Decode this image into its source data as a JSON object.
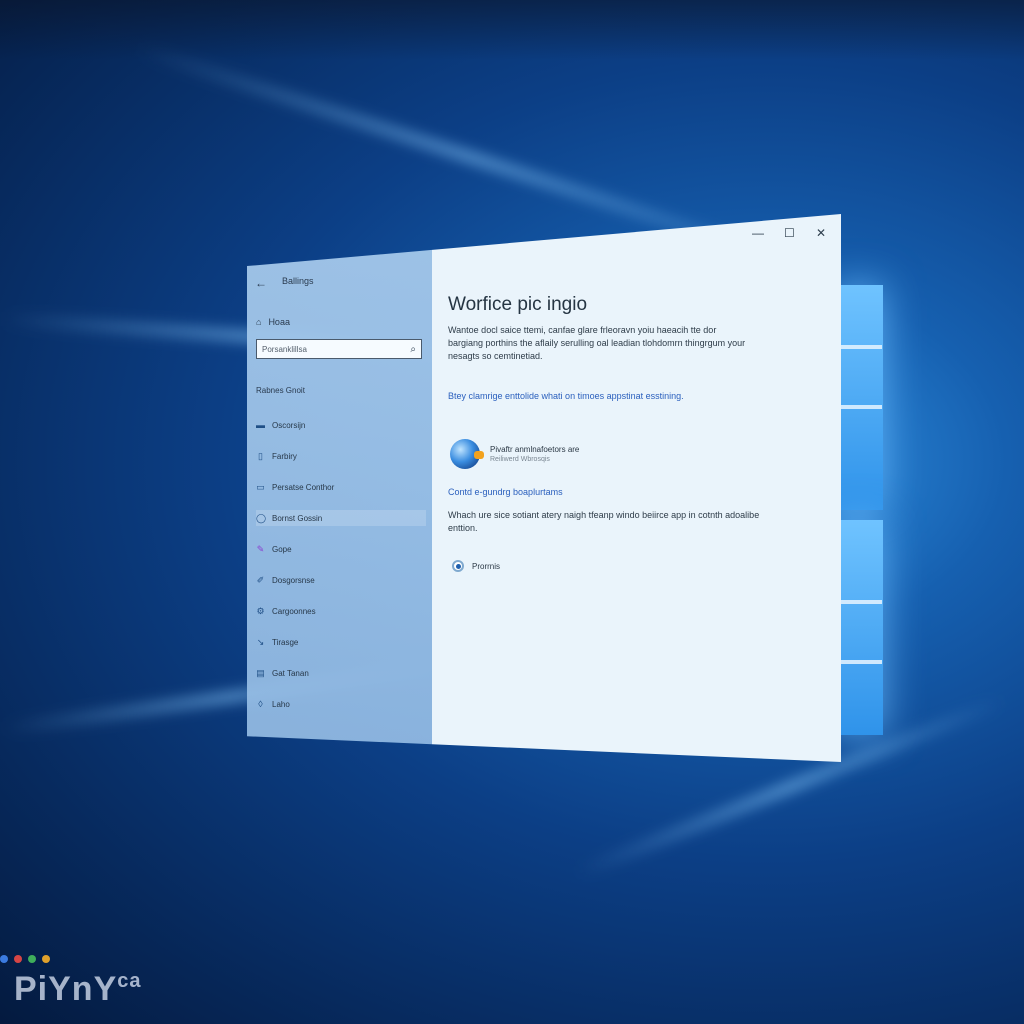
{
  "window": {
    "title": "Ballings",
    "controls": {
      "minimize": "—",
      "maximize": "☐",
      "close": "✕"
    }
  },
  "sidebar": {
    "back_glyph": "←",
    "home_label": "Hoaa",
    "search_placeholder": "Porsanklillsa",
    "section_label": "Rabnes Gnoit",
    "items": [
      {
        "label": "Oscorsijn",
        "icon": "display-icon"
      },
      {
        "label": "Farbiry",
        "icon": "file-icon"
      },
      {
        "label": "Persatse Conthor",
        "icon": "window-icon"
      },
      {
        "label": "Bornst Gossin",
        "icon": "lock-icon"
      },
      {
        "label": "Gope",
        "icon": "palette-icon"
      },
      {
        "label": "Dosgorsnse",
        "icon": "brush-icon"
      },
      {
        "label": "Cargoonnes",
        "icon": "gear-icon"
      },
      {
        "label": "Tirasge",
        "icon": "tools-icon"
      },
      {
        "label": "Gat Tanan",
        "icon": "storage-icon"
      },
      {
        "label": "Laho",
        "icon": "lock-icon"
      }
    ]
  },
  "content": {
    "heading": "Worfice pic ingio",
    "paragraph": "Wantoe docl saice ttemi, canfae glare frleoravn yoiu haeacih tte dor bargiang porthins the aflaily serulling oal leadian tlohdomrn thingrgum your nesagts so cemtinetiad.",
    "link": "Btey clamrige enttolide whati on timoes appstinat esstining.",
    "app": {
      "name": "Pivaftr anmlnafoetors are",
      "subtitle": "Reiliwerd Wbrosqis"
    },
    "sub_link": "Contd e-gundrg boaplurtams",
    "sub_description": "Whach ure sice sotiant atery naigh tfeanp windo beiirce app in cotnth adoalibe enttion.",
    "radio_label": "Prorrnis"
  },
  "watermark": {
    "text": "PiYnY",
    "suffix": "ca"
  },
  "colors": {
    "accent": "#2a5fbd",
    "desktop": "#0c3f86",
    "window_bg": "#eaf4fb"
  }
}
